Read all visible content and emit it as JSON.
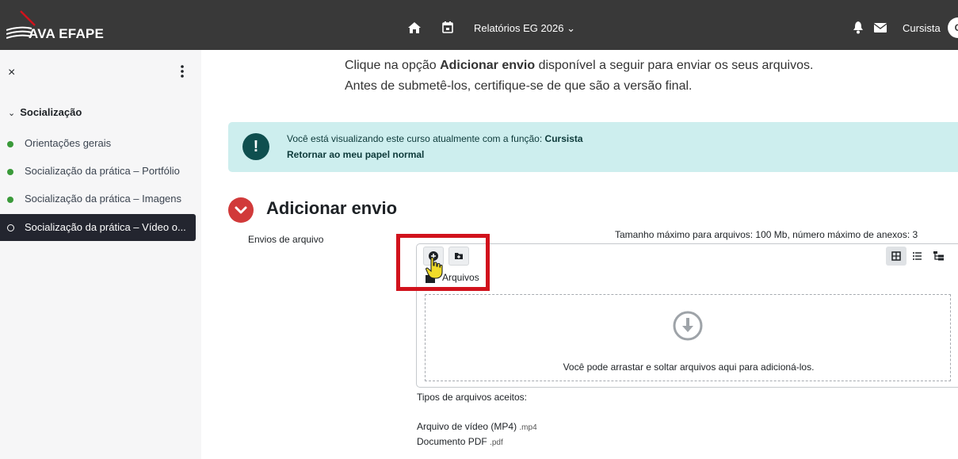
{
  "navbar": {
    "brand": "AVA EFAPE",
    "reports_label": "Relatórios EG 2026",
    "user_name": "Cursista",
    "avatar_initial": "C",
    "icons": [
      "home-icon",
      "calendar-icon",
      "bell-icon",
      "mail-icon"
    ]
  },
  "sidebar": {
    "close": "×",
    "section": "Socialização",
    "items": [
      {
        "label": "Orientações gerais",
        "active": false
      },
      {
        "label": "Socialização da prática – Portfólio",
        "active": false
      },
      {
        "label": "Socialização da prática – Imagens",
        "active": false
      },
      {
        "label": "Socialização da prática – Vídeo o...",
        "active": true
      }
    ]
  },
  "main": {
    "intro_prefix": "Clique na opção ",
    "intro_bold": "Adicionar envio",
    "intro_suffix": " disponível a seguir para enviar os seus arquivos.",
    "intro_line2": "Antes de submetê-los, certifique-se de que são a versão final.",
    "alert": {
      "text": "Você está visualizando este curso atualmente com a função: ",
      "role": "Cursista",
      "return_link": "Retornar ao meu papel normal"
    },
    "section_title": "Adicionar envio",
    "field_label": "Envios de arquivo",
    "max_size_text": "Tamanho máximo para arquivos: 100 Mb, número máximo de anexos: 3",
    "file_picker": {
      "path_label": "Arquivos",
      "drop_text": "Você pode arrastar e soltar arquivos aqui para adicioná-los."
    },
    "accepted_title": "Tipos de arquivos aceitos:",
    "accepted_types": [
      {
        "name": "Arquivo de vídeo (MP4)",
        "ext": ".mp4"
      },
      {
        "name": "Documento PDF",
        "ext": ".pdf"
      }
    ]
  },
  "colors": {
    "navbar": "#393939",
    "alert_bg": "#cdeeee",
    "collapse_red": "#d13a3a",
    "highlight_red": "#d1121c",
    "active_sidebar": "#23252f"
  }
}
